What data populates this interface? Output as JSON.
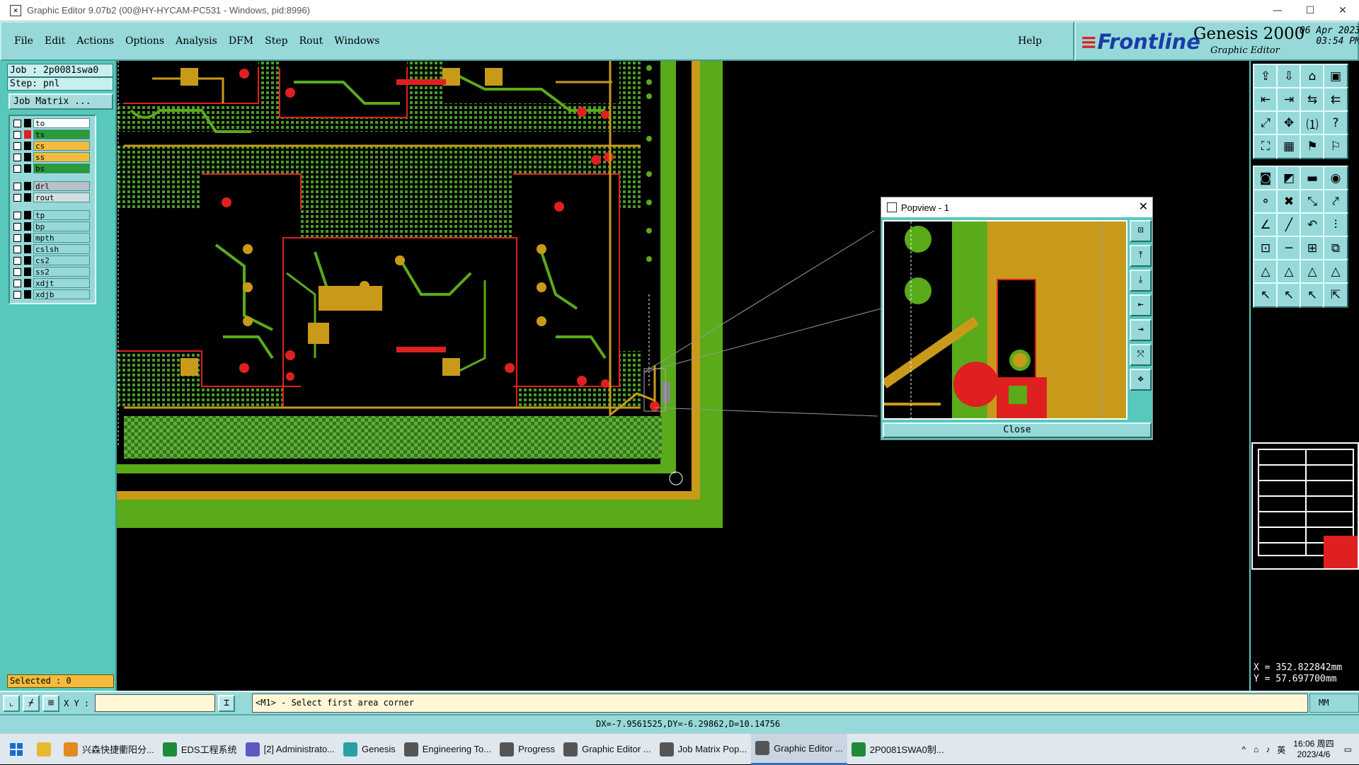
{
  "window": {
    "title": "Graphic Editor 9.07b2 (00@HY-HYCAM-PC531 - Windows, pid:8996)",
    "min": "—",
    "max": "☐",
    "close": "✕"
  },
  "menu": [
    "File",
    "Edit",
    "Actions",
    "Options",
    "Analysis",
    "DFM",
    "Step",
    "Rout",
    "Windows"
  ],
  "help": "Help",
  "brand": {
    "logo": "Frontline",
    "product": "Genesis 2000",
    "subtitle": "Graphic Editor",
    "date": "06 Apr 2023",
    "time": "03:54 PM"
  },
  "job": "Job : 2p0081swa0",
  "step": "Step: pnl",
  "job_matrix": "Job Matrix ...",
  "layers": [
    {
      "name": "to",
      "color": "#ffffff",
      "swatch": "#000000",
      "gap": false
    },
    {
      "name": "ts",
      "color": "#2a9a3a",
      "swatch": "#e02020",
      "gap": false
    },
    {
      "name": "cs",
      "color": "#f4bb3c",
      "swatch": "#000000",
      "gap": false
    },
    {
      "name": "ss",
      "color": "#f4bb3c",
      "swatch": "#000000",
      "gap": false
    },
    {
      "name": "bs",
      "color": "#2a9a3a",
      "swatch": "#000000",
      "gap": false
    },
    {
      "name": "drl",
      "color": "#b8c0c8",
      "swatch": "#000000",
      "gap": true
    },
    {
      "name": "rout",
      "color": "#d0e0e0",
      "swatch": "#000000",
      "gap": false
    },
    {
      "name": "tp",
      "color": "#96d9d8",
      "swatch": "#000000",
      "gap": true
    },
    {
      "name": "bp",
      "color": "#96d9d8",
      "swatch": "#000000",
      "gap": false
    },
    {
      "name": "mpth",
      "color": "#96d9d8",
      "swatch": "#000000",
      "gap": false
    },
    {
      "name": "cslsh",
      "color": "#96d9d8",
      "swatch": "#000000",
      "gap": false
    },
    {
      "name": "cs2",
      "color": "#96d9d8",
      "swatch": "#000000",
      "gap": false
    },
    {
      "name": "ss2",
      "color": "#96d9d8",
      "swatch": "#000000",
      "gap": false
    },
    {
      "name": "xdjt",
      "color": "#96d9d8",
      "swatch": "#000000",
      "gap": false
    },
    {
      "name": "xdjb",
      "color": "#96d9d8",
      "swatch": "#000000",
      "gap": false
    }
  ],
  "selected": "Selected : 0",
  "xy_label": "X Y :",
  "prompt": "<M1> - Select first area corner",
  "unit": "MM",
  "coords": {
    "x": "X = 352.822842mm",
    "y": "Y = 57.697700mm"
  },
  "status": "DX=-7.9561525,DY=-6.29862,D=10.14756",
  "popview": {
    "title": "Popview - 1",
    "close": "Close"
  },
  "taskbar": [
    {
      "label": "兴森快捷衢阳分...",
      "color": "#e08a20",
      "active": false
    },
    {
      "label": "EDS工程系统",
      "color": "#1e8a3a",
      "active": false
    },
    {
      "label": "[2] Administrato...",
      "color": "#5a5ac0",
      "active": false
    },
    {
      "label": "Genesis",
      "color": "#2aa0a0",
      "active": false
    },
    {
      "label": "Engineering To...",
      "color": "#555555",
      "active": false
    },
    {
      "label": "Progress",
      "color": "#555555",
      "active": false
    },
    {
      "label": "Graphic Editor ...",
      "color": "#555555",
      "active": false
    },
    {
      "label": "Job Matrix Pop...",
      "color": "#555555",
      "active": false
    },
    {
      "label": "Graphic Editor ...",
      "color": "#555555",
      "active": true
    },
    {
      "label": "2P0081SWA0制...",
      "color": "#1e8a3a",
      "active": false
    }
  ],
  "clock": {
    "time": "16:06 周四",
    "date": "2023/4/6"
  },
  "ime": "英"
}
